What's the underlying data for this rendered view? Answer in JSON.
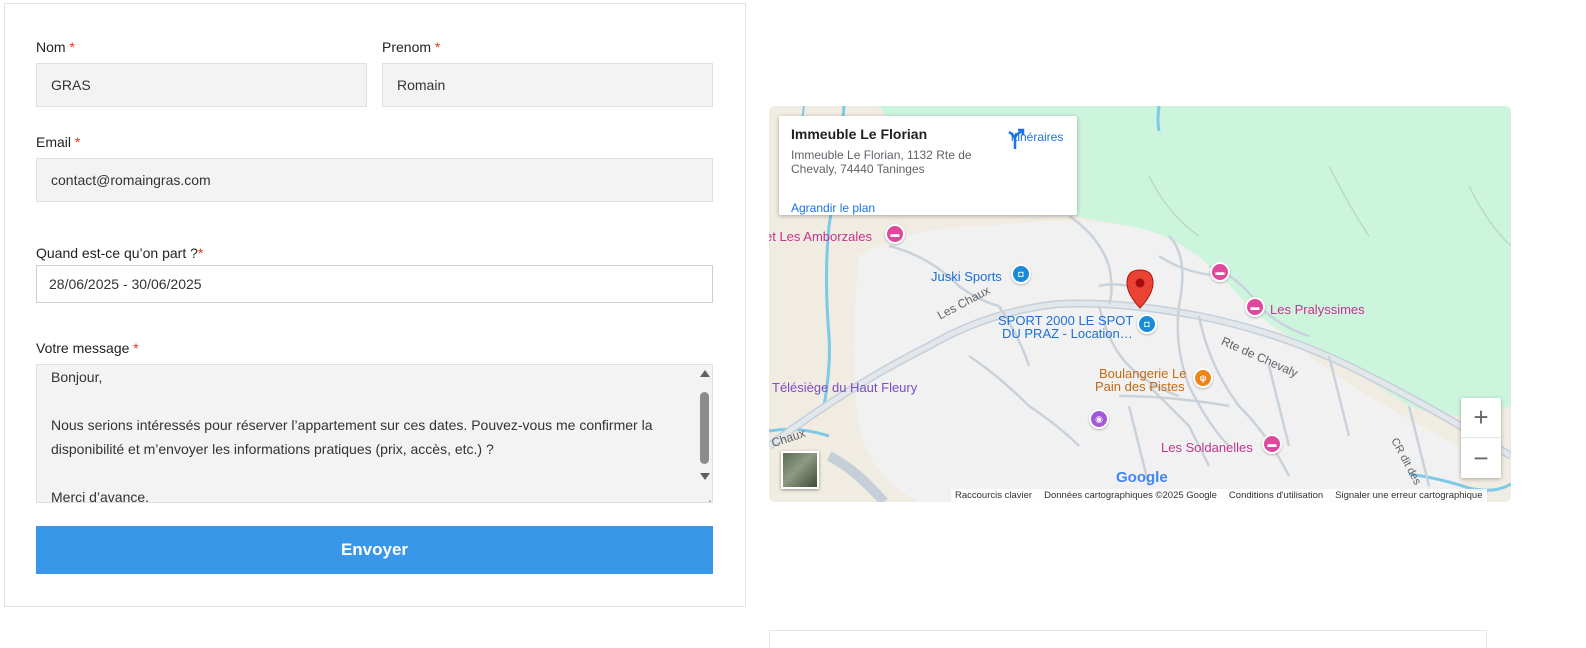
{
  "form": {
    "nom": {
      "label": "Nom",
      "required": "*",
      "value": "GRAS"
    },
    "prenom": {
      "label": "Prenom",
      "required": "*",
      "value": "Romain"
    },
    "email": {
      "label": "Email",
      "required": "*",
      "value": "contact@romaingras.com"
    },
    "dates": {
      "label": "Quand est-ce qu’on part ?",
      "required": "*",
      "value": "28/06/2025 - 30/06/2025"
    },
    "message": {
      "label": "Votre message",
      "required": "*",
      "value": "Bonjour,\n\nNous serions intéressés pour réserver l’appartement sur ces dates. Pouvez-vous me confirmer la disponibilité et m’envoyer les informations pratiques (prix, accès, etc.) ?\n\nMerci d’avance."
    },
    "submit_label": "Envoyer"
  },
  "map": {
    "place_title": "Immeuble Le Florian",
    "place_address": "Immeuble Le Florian, 1132 Rte de Chevaly, 74440 Taninges",
    "directions_label": "Itinéraires",
    "enlarge_label": "Agrandir le plan",
    "labels": {
      "amborzales": "et Les Amborzales",
      "juski": "Juski Sports",
      "sport2000_line1": "SPORT 2000 LE SPOT",
      "sport2000_line2": "DU PRAZ - Location…",
      "pralyssimes": "Les Pralyssimes",
      "boulangerie_line1": "Boulangerie Le",
      "boulangerie_line2": "Pain des Pistes",
      "telesiege": "Télésiège du Haut Fleury",
      "soldanelles": "Les Soldanelles",
      "road_chaux": "Les Chaux",
      "road_chaux2": "Chaux",
      "road_chevaly": "Rte de Chevaly",
      "road_cr": "CR dit des"
    },
    "zoom_in": "+",
    "zoom_out": "−",
    "google": "Google",
    "attribution": {
      "shortcuts": "Raccourcis clavier",
      "data": "Données cartographiques ©2025 Google",
      "terms": "Conditions d'utilisation",
      "report": "Signaler une erreur cartographique"
    },
    "colors": {
      "marker": "#ea4335",
      "forest": "#cdf5dd",
      "water": "#7ec8e8",
      "road": "#c6cfd8"
    }
  }
}
